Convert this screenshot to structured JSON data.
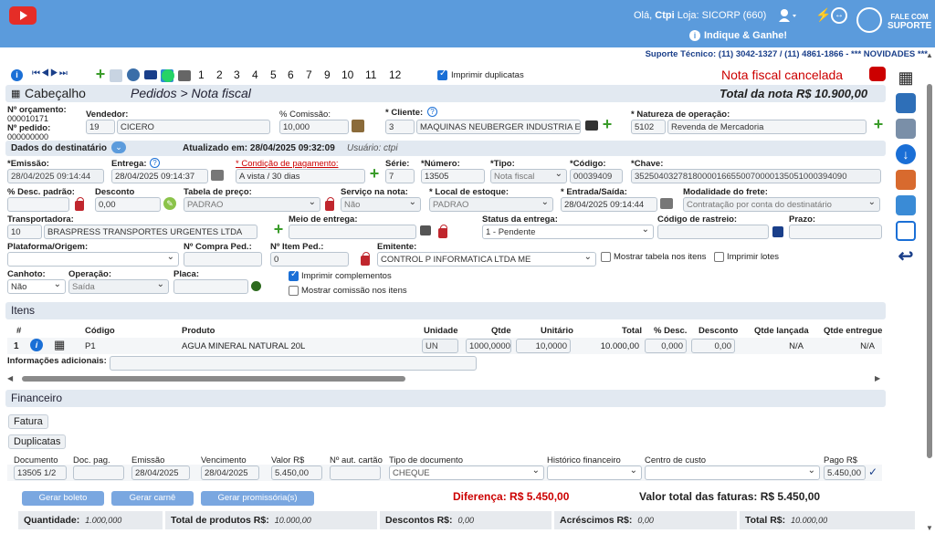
{
  "topbar": {
    "greeting": "Olá,",
    "user": "Ctpi",
    "store": "Loja: SICORP (660)",
    "invite": "Indique & Ganhe!",
    "support_top": "FALE COM",
    "support_bottom": "SUPORTE"
  },
  "infobar": {
    "text": "Suporte Técnico: (11) 3042-1327 / (11) 4861-1866 - *** NOVIDADES ***"
  },
  "toolbar": {
    "pages": [
      "1",
      "2",
      "3",
      "4",
      "5",
      "6",
      "7",
      "9",
      "10",
      "11",
      "12"
    ],
    "print_dup_label": "Imprimir duplicatas"
  },
  "status": {
    "cancelled": "Nota fiscal cancelada",
    "total": "Total da nota R$ 10.900,00"
  },
  "header": {
    "title": "Cabeçalho",
    "breadcrumb": "Pedidos > Nota fiscal"
  },
  "form": {
    "orc_label": "Nº orçamento:",
    "orc_value": "000010171",
    "ped_label": "Nº pedido:",
    "ped_value": "000000000",
    "vendedor_label": "Vendedor:",
    "vendedor_code": "19",
    "vendedor_name": "CICERO",
    "comissao_label": "% Comissão:",
    "comissao_value": "10,000",
    "cliente_label": "* Cliente:",
    "cliente_code": "3",
    "cliente_name": "MAQUINAS NEUBERGER INDUSTRIA E C",
    "natureza_label": "* Natureza de operação:",
    "natureza_code": "5102",
    "natureza_name": "Revenda de Mercadoria",
    "dest_label": "Dados do destinatário",
    "updated": "Atualizado em: 28/04/2025 09:32:09",
    "usuario": "Usuário: ctpi",
    "emissao_label": "*Emissão:",
    "emissao_value": "28/04/2025 09:14:44",
    "entrega_label": "Entrega:",
    "entrega_value": "28/04/2025 09:14:37",
    "cond_label": "* Condição de pagamento:",
    "cond_value": "A vista / 30 dias",
    "serie_label": "Série:",
    "serie_value": "7",
    "numero_label": "*Número:",
    "numero_value": "13505",
    "tipo_label": "*Tipo:",
    "tipo_value": "Nota fiscal",
    "codigo_label": "*Código:",
    "codigo_value": "00039409",
    "chave_label": "*Chave:",
    "chave_value": "35250403278180000166550070000135051000394090",
    "desc_padrao_label": "% Desc. padrão:",
    "desconto_label": "Desconto",
    "desconto_value": "0,00",
    "tabela_label": "Tabela de preço:",
    "tabela_value": "PADRAO",
    "servico_label": "Serviço na nota:",
    "servico_value": "Não",
    "local_label": "* Local de estoque:",
    "local_value": "PADRAO",
    "entrada_label": "* Entrada/Saída:",
    "entrada_value": "28/04/2025 09:14:44",
    "frete_label": "Modalidade do frete:",
    "frete_value": "Contratação por conta do destinatário",
    "transp_label": "Transportadora:",
    "transp_code": "10",
    "transp_name": "BRASPRESS TRANSPORTES URGENTES LTDA",
    "meio_label": "Meio de entrega:",
    "status_entrega_label": "Status da entrega:",
    "status_entrega_value": "1 - Pendente",
    "rastreio_label": "Código de rastreio:",
    "prazo_label": "Prazo:",
    "plataforma_label": "Plataforma/Origem:",
    "compra_label": "Nº Compra Ped.:",
    "item_ped_label": "Nº Item Ped.:",
    "item_ped_value": "0",
    "emitente_label": "Emitente:",
    "emitente_value": "CONTROL P INFORMATICA LTDA ME",
    "mostrar_tabela": "Mostrar tabela nos itens",
    "imprimir_lotes": "Imprimir lotes",
    "canhoto_label": "Canhoto:",
    "canhoto_value": "Não",
    "operacao_label": "Operação:",
    "operacao_value": "Saída",
    "placa_label": "Placa:",
    "imprimir_comp": "Imprimir complementos",
    "mostrar_comissao": "Mostrar comissão nos itens"
  },
  "itens": {
    "title": "Itens",
    "headers": [
      "#",
      "Código",
      "Produto",
      "Unidade",
      "Qtde",
      "Unitário",
      "Total",
      "% Desc.",
      "Desconto",
      "Qtde lançada",
      "Qtde entregue"
    ],
    "row": {
      "n": "1",
      "codigo": "P1",
      "produto": "AGUA MINERAL NATURAL 20L",
      "unidade": "UN",
      "qtde": "1000,0000",
      "unitario": "10,0000",
      "total": "10.000,00",
      "pdesc": "0,000",
      "desconto": "0,00",
      "lancada": "N/A",
      "entregue": "N/A"
    },
    "info_label": "Informações adicionais:"
  },
  "financeiro": {
    "title": "Financeiro",
    "fatura": "Fatura",
    "duplicatas": "Duplicatas",
    "headers": [
      "Documento",
      "Doc. pag.",
      "Emissão",
      "Vencimento",
      "Valor R$",
      "Nº aut. cartão",
      "Tipo de documento",
      "Histórico financeiro",
      "Centro de custo",
      "Pago R$"
    ],
    "row": {
      "documento": "13505 1/2",
      "emissao": "28/04/2025",
      "vencimento": "28/04/2025",
      "valor": "5.450,00",
      "tipo": "CHEQUE",
      "pago": "5.450,00"
    },
    "gerar_boleto": "Gerar boleto",
    "gerar_carne": "Gerar carnê",
    "gerar_promissoria": "Gerar promissória(s)",
    "diferenca": "Diferença: R$ 5.450,00",
    "valor_total": "Valor total das faturas: R$ 5.450,00"
  },
  "footer": {
    "qtd_label": "Quantidade:",
    "qtd_value": "1.000,000",
    "prod_label": "Total de produtos R$:",
    "prod_value": "10.000,00",
    "desc_label": "Descontos R$:",
    "desc_value": "0,00",
    "acr_label": "Acréscimos R$:",
    "acr_value": "0,00",
    "total_label": "Total R$:",
    "total_value": "10.000,00"
  },
  "colors": {
    "topbar": "#5b9bdc",
    "accent": "#1a6fd6",
    "red": "#c00000",
    "green": "#3a9c2a"
  }
}
